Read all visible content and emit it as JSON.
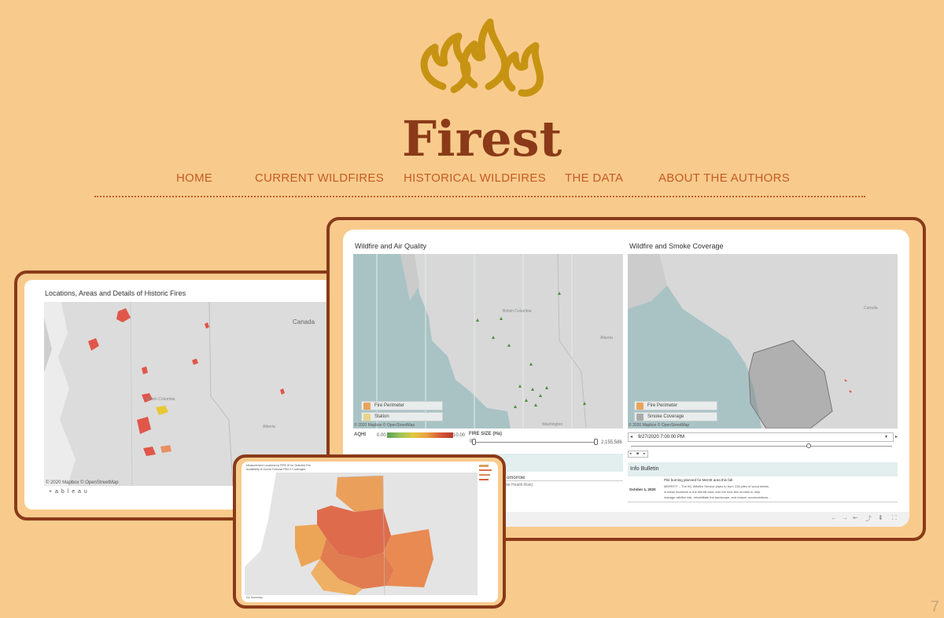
{
  "logo": {
    "text": "Firest"
  },
  "nav": {
    "items": [
      {
        "label": "HOME"
      },
      {
        "label": "CURRENT WILDFIRES"
      },
      {
        "label": "HISTORICAL WILDFIRES"
      },
      {
        "label": "THE DATA"
      },
      {
        "label": "ABOUT THE AUTHORS"
      }
    ]
  },
  "historic": {
    "title": "Locations, Areas and Details of Historic Fires",
    "map_label_canada": "Canada",
    "map_label_bc": "British Columbia",
    "map_label_alberta": "Alberta",
    "attribution": "© 2020 Mapbox © OpenStreetMap",
    "tableau": "+ a b l e a u"
  },
  "air": {
    "title": "Wildfire and Air Quality",
    "map_label_bc": "British Columbia",
    "map_label_alberta": "Alberta",
    "map_label_washington": "Washington",
    "legend_fire": "Fire Perimeter",
    "legend_station": "Station",
    "attribution": "© 2020 Mapbox © OpenStreetMap",
    "aqhi_label": "AQHI",
    "aqhi_min": "0.00",
    "aqhi_max": "10.00",
    "size_label": "FIRE SIZE (Ha)",
    "size_min": "0",
    "size_max": "2,155,586",
    "forecast_word": "omorrow",
    "source_note": "ste Health Risk)"
  },
  "smoke": {
    "title": "Wildfire and Smoke Coverage",
    "map_label_canada": "Canada",
    "legend_fire": "Fire Perimeter",
    "legend_smoke": "Smoke Coverage",
    "attribution": "© 2020 Mapbox © OpenStreetMap",
    "date_value": "9/27/2020 7:00:00 PM",
    "bulletin_title": "Info Bulletin",
    "bulletin_date": "October 1, 2020",
    "bulletin_headline": "Pile burning planned for Merritt area this fall",
    "bulletin_line1": "MERRITT – The BC Wildfire Service plans to burn 228 piles of wood debris",
    "bulletin_line2": "in these locations in the Merritt area over the next few months to help",
    "bulletin_line3": "manage wildfire risk, rehabilitate the landscape, and reduce accumulations…"
  },
  "region": {
    "caption1": "Measurement Locations by FIRE ID for Selected Fire",
    "caption2": "Availability of Ozone Forecast PM2.5 Coverages",
    "footer": "DX Summary"
  },
  "page_number": "7",
  "colors": {
    "background": "#f8cb8d",
    "frame": "#8a3a18",
    "nav_text": "#c55a24",
    "logo_flame": "#c79312",
    "logo_text": "#8a3a18"
  }
}
